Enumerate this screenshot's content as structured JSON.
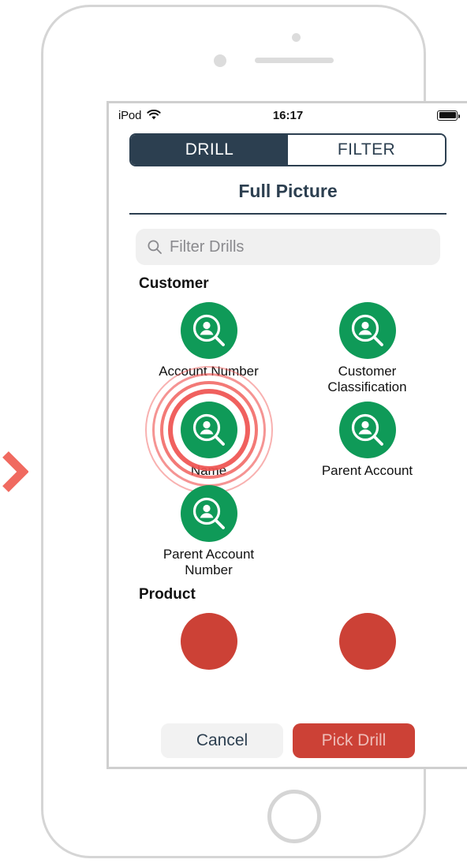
{
  "colors": {
    "brand_green": "#0f9a58",
    "navy": "#2c3f50",
    "red": "#cc4136",
    "ripple_red": "#ef5350",
    "pointer_red": "#f06a60",
    "search_bg": "#f0f0f0"
  },
  "pointer": {
    "icon": "chevron-right-icon"
  },
  "status_bar": {
    "carrier": "iPod",
    "wifi_icon": "wifi-icon",
    "time": "16:17",
    "battery_icon": "battery-full-icon"
  },
  "segmented_control": {
    "selected": "DRILL",
    "options": [
      {
        "label": "DRILL",
        "active": true
      },
      {
        "label": "FILTER",
        "active": false
      }
    ]
  },
  "header": {
    "title": "Full Picture"
  },
  "search": {
    "icon": "search-icon",
    "placeholder": "Filter Drills",
    "value": ""
  },
  "sections": [
    {
      "header": "Customer",
      "items": [
        {
          "label": "Account Number",
          "icon": "person-search-icon",
          "highlighted": false
        },
        {
          "label": "Customer\nClassification",
          "icon": "person-search-icon",
          "highlighted": false
        },
        {
          "label": "Name",
          "icon": "person-search-icon",
          "highlighted": true
        },
        {
          "label": "Parent Account",
          "icon": "person-search-icon",
          "highlighted": false
        },
        {
          "label": "Parent Account\nNumber",
          "icon": "person-search-icon",
          "highlighted": false
        }
      ]
    },
    {
      "header": "Product",
      "items": [
        {
          "label": "",
          "icon": "product-icon",
          "highlighted": false
        },
        {
          "label": "",
          "icon": "product-icon",
          "highlighted": false
        }
      ]
    }
  ],
  "footer": {
    "cancel_label": "Cancel",
    "pick_label": "Pick Drill"
  },
  "labels": {
    "account_number": "Account Number",
    "customer_classification_l1": "Customer",
    "customer_classification_l2": "Classification",
    "name": "Name",
    "parent_account": "Parent Account",
    "parent_account_number_l1": "Parent Account",
    "parent_account_number_l2": "Number",
    "section_customer": "Customer",
    "section_product": "Product"
  }
}
